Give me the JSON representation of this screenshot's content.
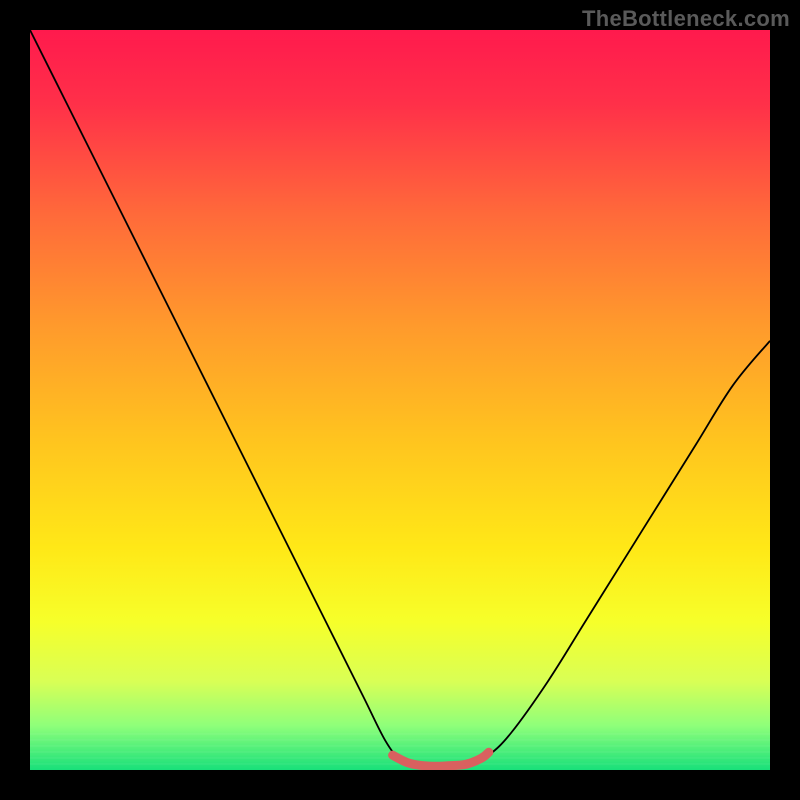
{
  "watermark": "TheBottleneck.com",
  "chart_data": {
    "type": "line",
    "title": "",
    "xlabel": "",
    "ylabel": "",
    "xlim": [
      0,
      100
    ],
    "ylim": [
      0,
      100
    ],
    "background_gradient": {
      "stops": [
        {
          "offset": 0.0,
          "color": "#ff1a4d"
        },
        {
          "offset": 0.1,
          "color": "#ff3049"
        },
        {
          "offset": 0.25,
          "color": "#ff6a3a"
        },
        {
          "offset": 0.4,
          "color": "#ff9a2c"
        },
        {
          "offset": 0.55,
          "color": "#ffc31f"
        },
        {
          "offset": 0.7,
          "color": "#ffe817"
        },
        {
          "offset": 0.8,
          "color": "#f6ff2a"
        },
        {
          "offset": 0.88,
          "color": "#d9ff55"
        },
        {
          "offset": 0.94,
          "color": "#8fff7a"
        },
        {
          "offset": 1.0,
          "color": "#18e07a"
        }
      ]
    },
    "series": [
      {
        "name": "curve",
        "color": "#000000",
        "width": 1.8,
        "points": [
          {
            "x": 0,
            "y": 100
          },
          {
            "x": 5,
            "y": 90
          },
          {
            "x": 10,
            "y": 80
          },
          {
            "x": 15,
            "y": 70
          },
          {
            "x": 20,
            "y": 60
          },
          {
            "x": 25,
            "y": 50
          },
          {
            "x": 30,
            "y": 40
          },
          {
            "x": 35,
            "y": 30
          },
          {
            "x": 40,
            "y": 20
          },
          {
            "x": 45,
            "y": 10
          },
          {
            "x": 48,
            "y": 4
          },
          {
            "x": 50,
            "y": 1.5
          },
          {
            "x": 52,
            "y": 0.8
          },
          {
            "x": 55,
            "y": 0.5
          },
          {
            "x": 58,
            "y": 0.6
          },
          {
            "x": 60,
            "y": 1.0
          },
          {
            "x": 62,
            "y": 2.0
          },
          {
            "x": 65,
            "y": 5
          },
          {
            "x": 70,
            "y": 12
          },
          {
            "x": 75,
            "y": 20
          },
          {
            "x": 80,
            "y": 28
          },
          {
            "x": 85,
            "y": 36
          },
          {
            "x": 90,
            "y": 44
          },
          {
            "x": 95,
            "y": 52
          },
          {
            "x": 100,
            "y": 58
          }
        ]
      },
      {
        "name": "highlight-band",
        "color": "#d9605f",
        "width": 9,
        "linecap": "round",
        "points": [
          {
            "x": 49,
            "y": 2.0
          },
          {
            "x": 51,
            "y": 1.0
          },
          {
            "x": 53,
            "y": 0.6
          },
          {
            "x": 55,
            "y": 0.5
          },
          {
            "x": 57,
            "y": 0.6
          },
          {
            "x": 59,
            "y": 0.8
          },
          {
            "x": 61,
            "y": 1.6
          },
          {
            "x": 62,
            "y": 2.4
          }
        ]
      }
    ]
  }
}
